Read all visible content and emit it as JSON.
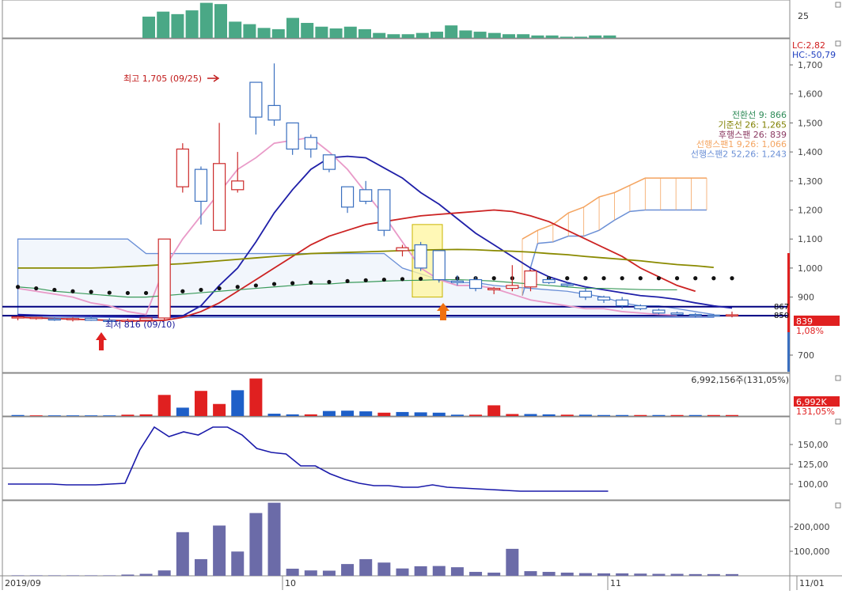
{
  "chart_data": {
    "type": "candlestick",
    "title": "",
    "top_panel": {
      "type": "bar",
      "color": "#4aa886",
      "axis_label": "25",
      "values": [
        8.5,
        10.5,
        9.5,
        11,
        14,
        13.5,
        6.5,
        5.5,
        4,
        3.5,
        8,
        6,
        4.5,
        3.8,
        4.5,
        3.5,
        2,
        1.5,
        1.5,
        2,
        2.5,
        5,
        3,
        2.5,
        2,
        1.5,
        1.5,
        1,
        1,
        0.5,
        0.5,
        1,
        1
      ]
    },
    "price_panel": {
      "y_ticks": [
        "1,700",
        "1,600",
        "1,500",
        "1,400",
        "1,300",
        "1,200",
        "1,100",
        "1,000",
        "900",
        "700"
      ],
      "ylim": [
        640,
        1790
      ],
      "lc_label": "LC:2,82",
      "hc_label": "HC:-50,79",
      "legend": [
        {
          "text": "전환선 9: 866",
          "color": "#2e8b57"
        },
        {
          "text": "기준선 26: 1,265",
          "color": "#808000"
        },
        {
          "text": "후행스팬 26: 839",
          "color": "#8b3a62"
        },
        {
          "text": "선행스팬1 9,26: 1,066",
          "color": "#f4a460"
        },
        {
          "text": "선행스팬2 52,26: 1,243",
          "color": "#6a8fd6"
        }
      ],
      "high_label": "최고 1,705 (09/25)",
      "low_label": "최저 816 (09/10)",
      "last_price_label": "839",
      "last_pct_label": "1,08%",
      "level_867": "867",
      "level_850": "850",
      "candles": [
        {
          "o": 830,
          "h": 835,
          "l": 820,
          "c": 832
        },
        {
          "o": 826,
          "h": 832,
          "l": 822,
          "c": 830
        },
        {
          "o": 825,
          "h": 830,
          "l": 818,
          "c": 822
        },
        {
          "o": 822,
          "h": 830,
          "l": 816,
          "c": 826
        },
        {
          "o": 826,
          "h": 835,
          "l": 818,
          "c": 820
        },
        {
          "o": 820,
          "h": 828,
          "l": 816,
          "c": 818
        },
        {
          "o": 818,
          "h": 825,
          "l": 816,
          "c": 820
        },
        {
          "o": 820,
          "h": 830,
          "l": 816,
          "c": 828
        },
        {
          "o": 828,
          "h": 1100,
          "l": 820,
          "c": 1100
        },
        {
          "o": 1280,
          "h": 1430,
          "l": 1260,
          "c": 1410
        },
        {
          "o": 1340,
          "h": 1350,
          "l": 1150,
          "c": 1230
        },
        {
          "o": 1130,
          "h": 1500,
          "l": 1130,
          "c": 1360
        },
        {
          "o": 1270,
          "h": 1400,
          "l": 1260,
          "c": 1300
        },
        {
          "o": 1640,
          "h": 1640,
          "l": 1460,
          "c": 1520
        },
        {
          "o": 1560,
          "h": 1705,
          "l": 1490,
          "c": 1510
        },
        {
          "o": 1500,
          "h": 1500,
          "l": 1390,
          "c": 1410
        },
        {
          "o": 1450,
          "h": 1460,
          "l": 1380,
          "c": 1410
        },
        {
          "o": 1390,
          "h": 1390,
          "l": 1330,
          "c": 1340
        },
        {
          "o": 1280,
          "h": 1280,
          "l": 1190,
          "c": 1210
        },
        {
          "o": 1270,
          "h": 1300,
          "l": 1220,
          "c": 1230
        },
        {
          "o": 1270,
          "h": 1270,
          "l": 1110,
          "c": 1130
        },
        {
          "o": 1060,
          "h": 1080,
          "l": 1040,
          "c": 1070
        },
        {
          "o": 1080,
          "h": 1090,
          "l": 990,
          "c": 1000
        },
        {
          "o": 1060,
          "h": 1060,
          "l": 950,
          "c": 960
        },
        {
          "o": 955,
          "h": 975,
          "l": 940,
          "c": 950
        },
        {
          "o": 960,
          "h": 970,
          "l": 920,
          "c": 930
        },
        {
          "o": 925,
          "h": 935,
          "l": 910,
          "c": 930
        },
        {
          "o": 930,
          "h": 1010,
          "l": 920,
          "c": 940
        },
        {
          "o": 935,
          "h": 995,
          "l": 920,
          "c": 990
        },
        {
          "o": 960,
          "h": 970,
          "l": 945,
          "c": 950
        },
        {
          "o": 945,
          "h": 950,
          "l": 935,
          "c": 940
        },
        {
          "o": 920,
          "h": 930,
          "l": 890,
          "c": 900
        },
        {
          "o": 900,
          "h": 905,
          "l": 880,
          "c": 890
        },
        {
          "o": 890,
          "h": 900,
          "l": 860,
          "c": 870
        },
        {
          "o": 870,
          "h": 875,
          "l": 855,
          "c": 860
        },
        {
          "o": 855,
          "h": 860,
          "l": 840,
          "c": 845
        },
        {
          "o": 845,
          "h": 850,
          "l": 835,
          "c": 840
        },
        {
          "o": 840,
          "h": 845,
          "l": 830,
          "c": 838
        },
        {
          "o": 838,
          "h": 842,
          "l": 832,
          "c": 836
        },
        {
          "o": 836,
          "h": 850,
          "l": 830,
          "c": 839
        }
      ]
    },
    "volume_panel": {
      "label": "6,992,156주(131,05%)",
      "last_label": "6,992K",
      "last_pct_label": "131,05%",
      "values": [
        0.3,
        0.2,
        0.2,
        0.2,
        0.2,
        0.2,
        0.4,
        0.5,
        6.3,
        2.5,
        7.5,
        3.6,
        7.7,
        11.2,
        0.7,
        0.5,
        0.5,
        1.5,
        1.6,
        1.4,
        1.0,
        1.2,
        1.1,
        1.0,
        0.4,
        0.4,
        3.2,
        0.6,
        0.6,
        0.5,
        0.4,
        0.4,
        0.3,
        0.3,
        0.3,
        0.3,
        0.3,
        0.3,
        0.3,
        0.3
      ],
      "colors": [
        "b",
        "r",
        "b",
        "b",
        "b",
        "b",
        "r",
        "r",
        "r",
        "b",
        "r",
        "r",
        "b",
        "r",
        "b",
        "b",
        "r",
        "b",
        "b",
        "b",
        "r",
        "b",
        "b",
        "b",
        "b",
        "r",
        "r",
        "r",
        "b",
        "b",
        "r",
        "b",
        "b",
        "b",
        "r",
        "b",
        "r",
        "b",
        "r",
        "r"
      ]
    },
    "indicator_panel": {
      "y_ticks": [
        "150,00",
        "125,00",
        "100,00"
      ],
      "ref_line": 120,
      "values": [
        100,
        100,
        100,
        100,
        99,
        99,
        99,
        100,
        101,
        143,
        172,
        160,
        166,
        162,
        172,
        172,
        162,
        145,
        140,
        138,
        123,
        123,
        113,
        106,
        101,
        98,
        98,
        96,
        96,
        99,
        96,
        95,
        94,
        93,
        92,
        91,
        91,
        91,
        91,
        91,
        91,
        91
      ]
    },
    "obv_panel": {
      "y_ticks": [
        "200,000",
        "100,000"
      ],
      "values": [
        2,
        2,
        2,
        2,
        2,
        2,
        5,
        8,
        22,
        178,
        68,
        205,
        99,
        256,
        298,
        29,
        22,
        21,
        48,
        68,
        54,
        30,
        39,
        40,
        35,
        16,
        13,
        110,
        19,
        16,
        13,
        11,
        10,
        10,
        9,
        8,
        8,
        7,
        7,
        7
      ]
    },
    "x_labels": [
      "2019/09",
      "10",
      "11",
      "11/01"
    ]
  }
}
